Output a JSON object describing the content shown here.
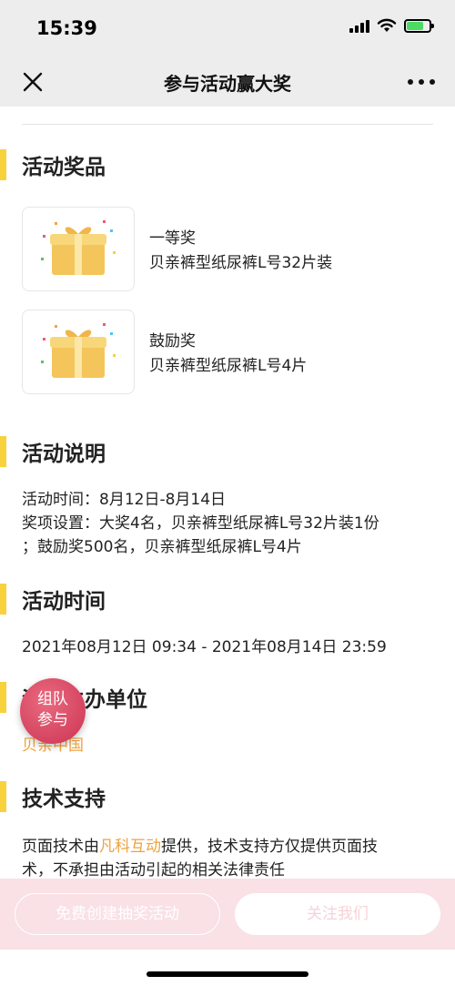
{
  "status_bar": {
    "time": "15:39"
  },
  "nav": {
    "title": "参与活动赢大奖"
  },
  "prizes_section": {
    "title": "活动奖品",
    "items": [
      {
        "level": "一等奖",
        "name": "贝亲裤型纸尿裤L号32片装"
      },
      {
        "level": "鼓励奖",
        "name": "贝亲裤型纸尿裤L号4片"
      }
    ]
  },
  "description_section": {
    "title": "活动说明",
    "line1": "活动时间：8月12日-8月14日",
    "line2": "奖项设置：大奖4名，贝亲裤型纸尿裤L号32片装1份",
    "line3": "；鼓励奖500名，贝亲裤型纸尿裤L号4片"
  },
  "time_section": {
    "title": "活动时间",
    "range": "2021年08月12日 09:34 - 2021年08月14日 23:59"
  },
  "organizer_section": {
    "title": "活动主办单位",
    "name": "贝亲中国"
  },
  "tech_section": {
    "title": "技术支持",
    "text_before": "页面技术由",
    "provider": "凡科互动",
    "text_after": "提供，技术支持方仅提供页面技",
    "line2": "术，不承担由活动引起的相关法律责任"
  },
  "team_float": {
    "line1": "组队",
    "line2": "参与"
  },
  "bottom_bar": {
    "create_label": "免费创建抽奖活动",
    "follow_label": "关注我们"
  },
  "colors": {
    "accent": "#f7d23c",
    "link": "#f0a23c",
    "float": "#cc3352",
    "bottom_bg": "#f9e1e6"
  }
}
